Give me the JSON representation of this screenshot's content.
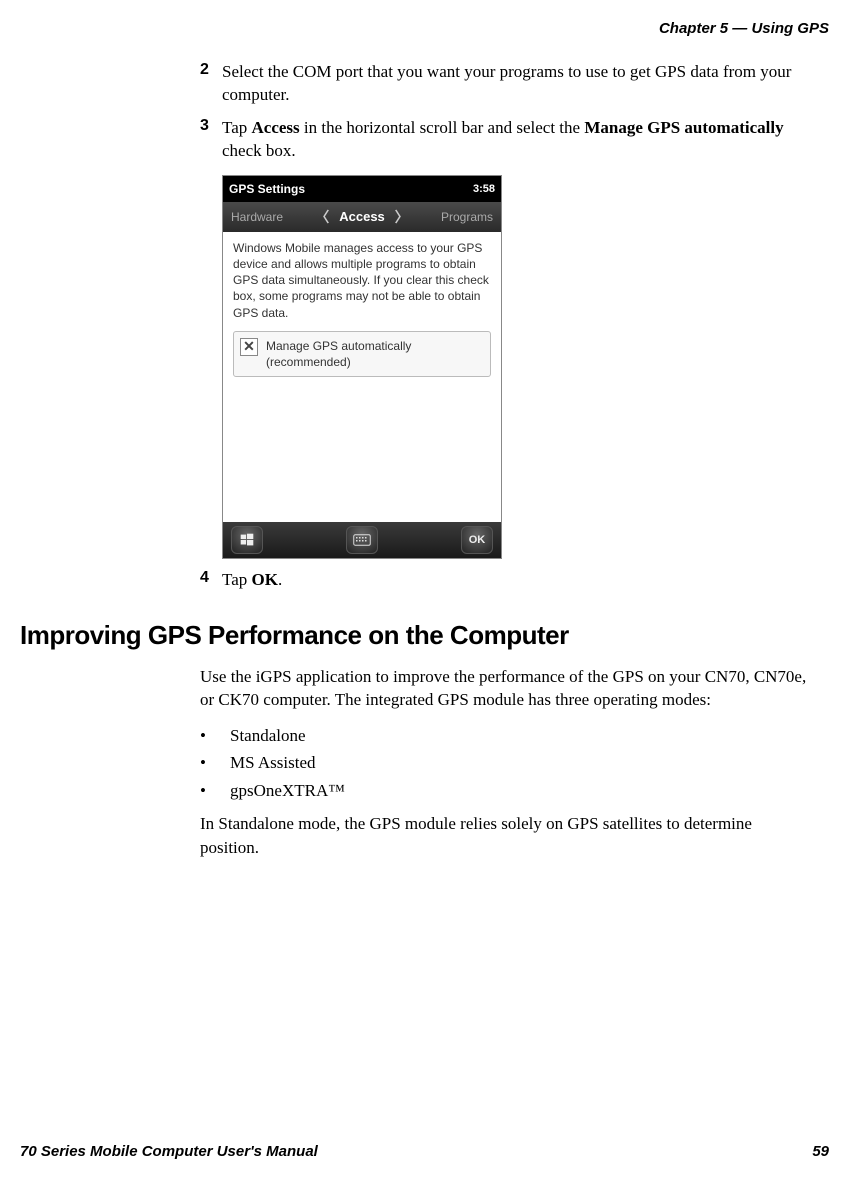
{
  "header": {
    "chapter": "Chapter 5 — Using GPS"
  },
  "steps": {
    "s2": {
      "num": "2",
      "text": "Select the COM port that you want your programs to use to get GPS data from your computer."
    },
    "s3": {
      "num": "3",
      "pre": "Tap ",
      "b1": "Access",
      "mid": " in the horizontal scroll bar and select the ",
      "b2": "Manage GPS automatically",
      "post": " check box."
    },
    "s4": {
      "num": "4",
      "pre": "Tap ",
      "b1": "OK",
      "post": "."
    }
  },
  "screenshot": {
    "title": "GPS Settings",
    "time": "3:58",
    "tabs": {
      "left": "Hardware",
      "center": "Access",
      "right": "Programs"
    },
    "body": "Windows Mobile manages access to your GPS device and allows multiple programs to obtain GPS data simultaneously. If you clear this check box, some programs may not be able to obtain GPS data.",
    "checkbox": {
      "label": "Manage GPS automatically (recommended)",
      "mark": "✕"
    },
    "ok": "OK"
  },
  "section": {
    "title": "Improving GPS Performance on the Computer"
  },
  "para1": "Use the iGPS application to improve the performance of the GPS on your CN70, CN70e, or CK70 computer. The integrated GPS module has three operating modes:",
  "bullets": {
    "b1": "Standalone",
    "b2": "MS Assisted",
    "b3": "gpsOneXTRA™"
  },
  "para2": "In Standalone mode, the GPS module relies solely on GPS satellites to determine position.",
  "footer": {
    "left": "70 Series Mobile Computer User's Manual",
    "right": "59"
  }
}
